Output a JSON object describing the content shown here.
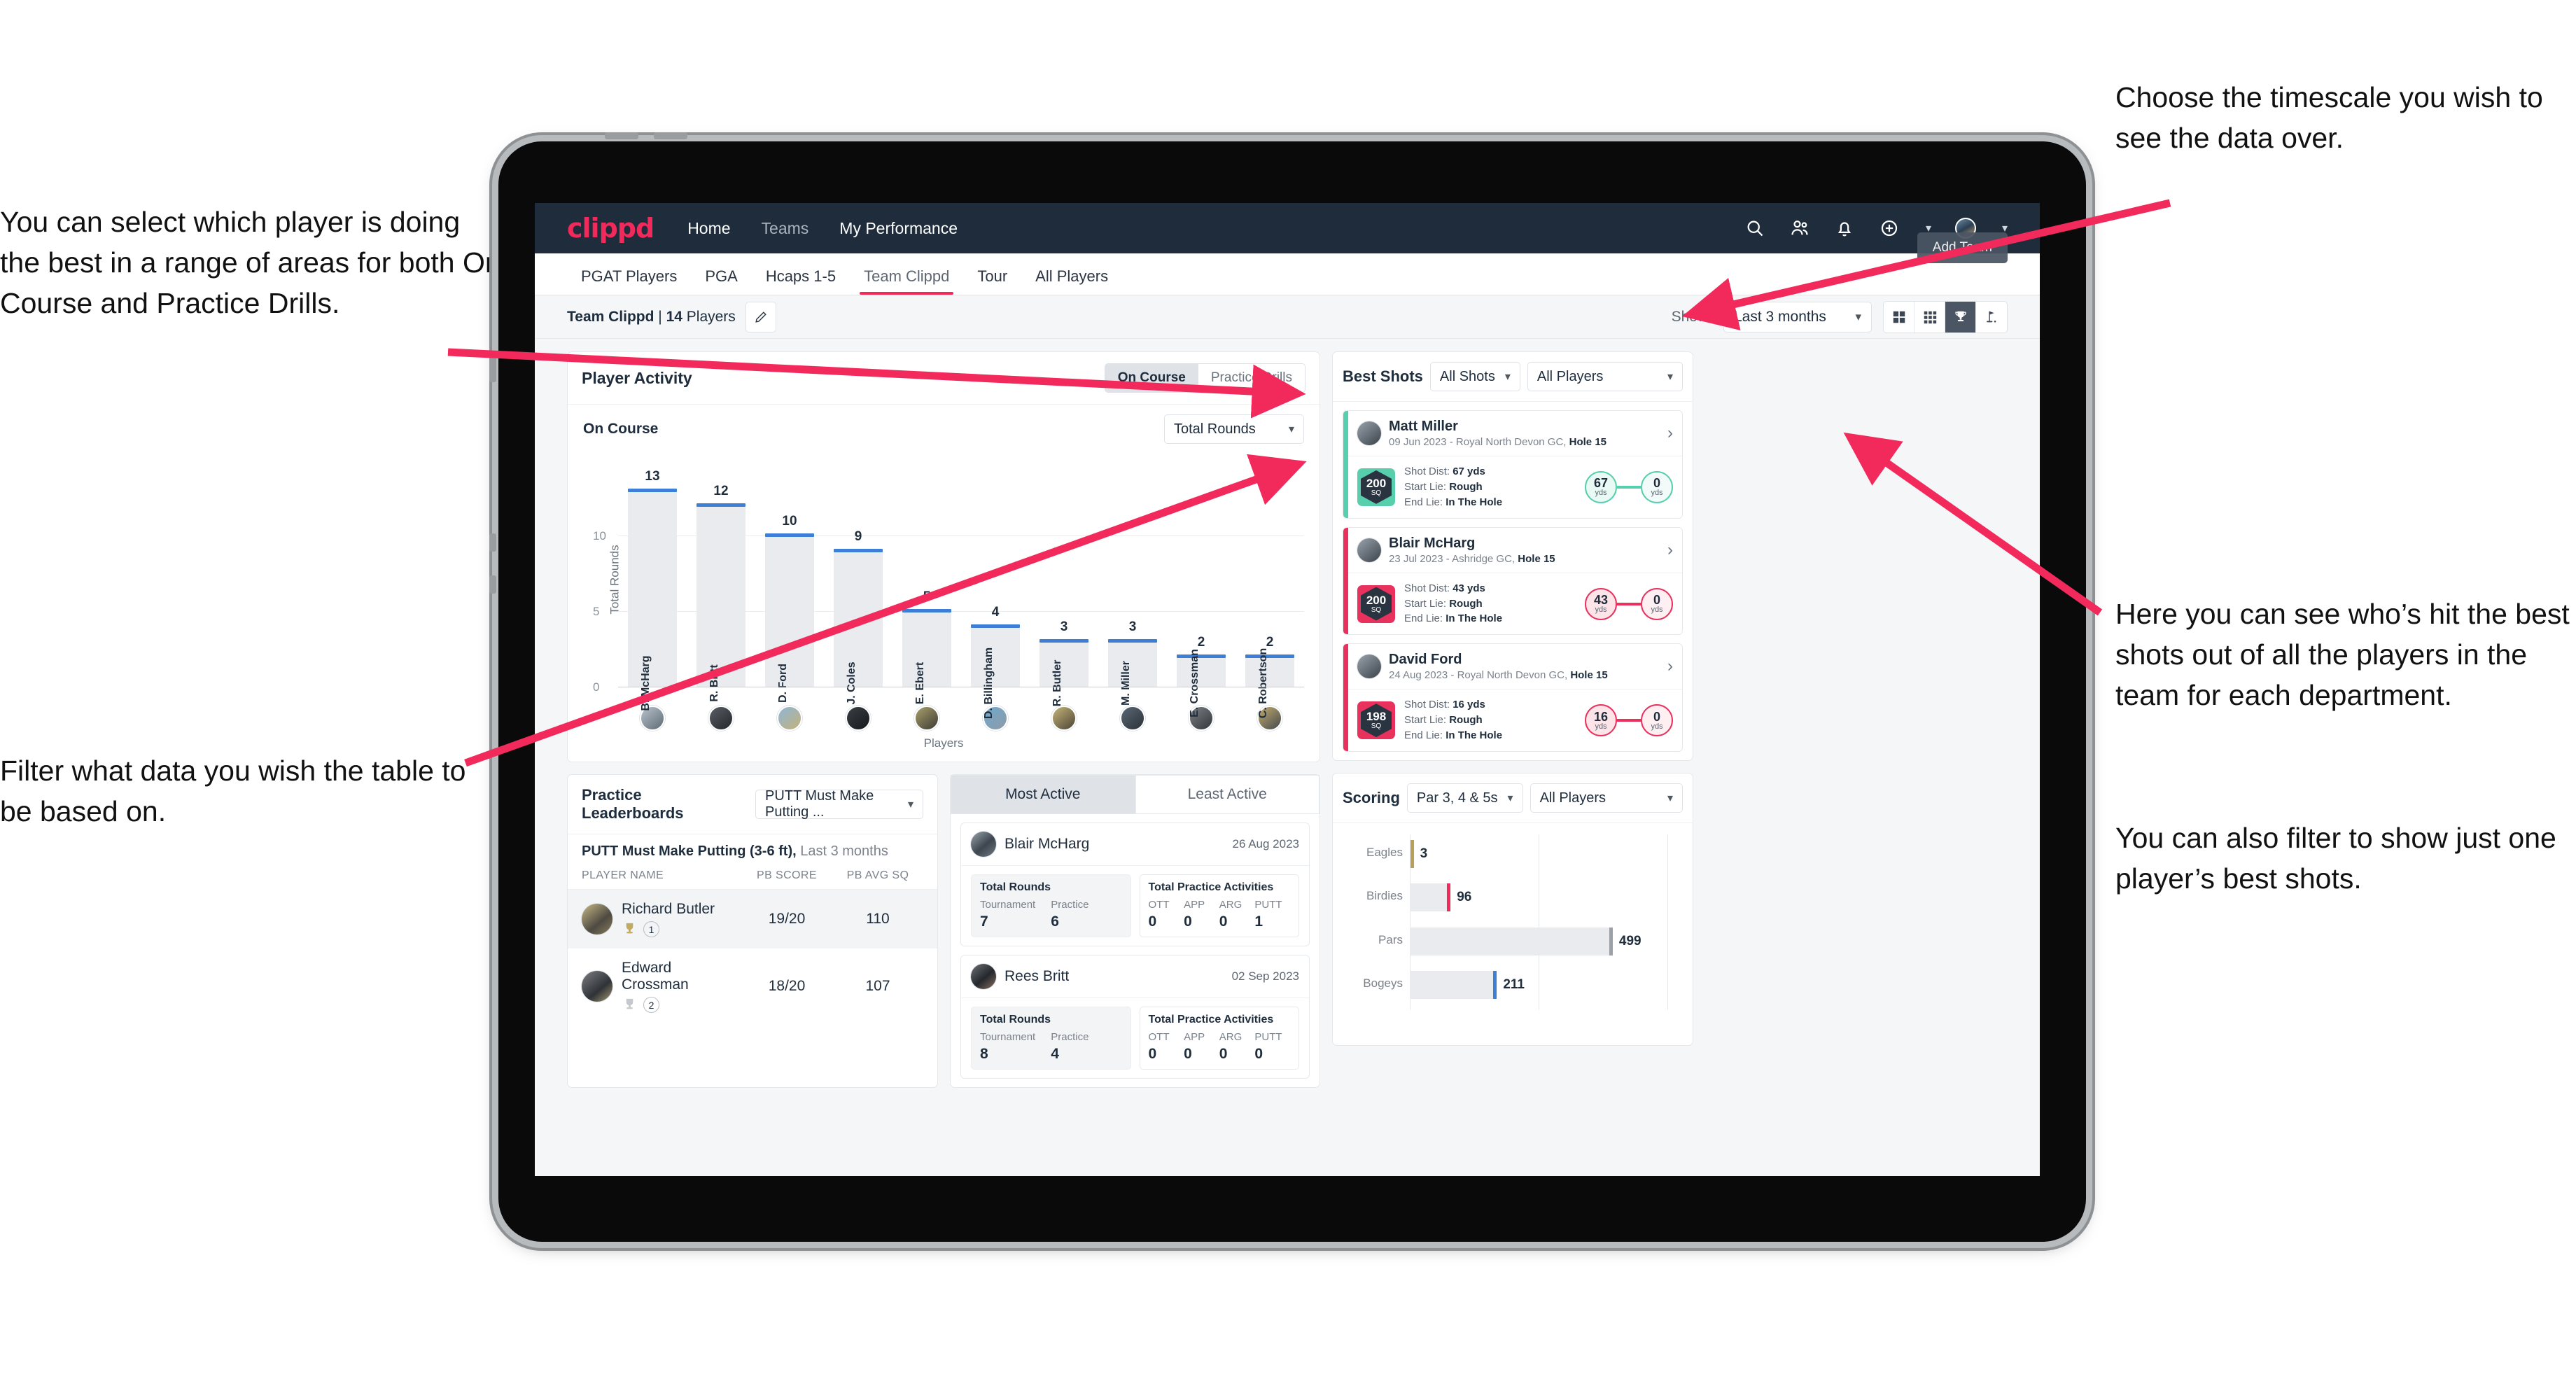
{
  "annotations": {
    "top_left": "You can select which player is doing the best in a range of areas for both On Course and Practice Drills.",
    "bottom_left": "Filter what data you wish the table to be based on.",
    "top_right": "Choose the timescale you wish to see the data over.",
    "middle_right": "Here you can see who’s hit the best shots out of all the players in the team for each department.",
    "middle_right_2": "You can also filter to show just one player’s best shots."
  },
  "topnav": {
    "logo": "clippd",
    "links": [
      {
        "label": "Home",
        "dim": false
      },
      {
        "label": "Teams",
        "dim": true
      },
      {
        "label": "My Performance",
        "dim": false
      }
    ],
    "icons": [
      "search-icon",
      "people-icon",
      "bell-icon",
      "plus-circle-icon",
      "avatar-icon"
    ]
  },
  "tabs": [
    {
      "label": "PGAT Players",
      "active": false
    },
    {
      "label": "PGA",
      "active": false
    },
    {
      "label": "Hcaps 1-5",
      "active": false
    },
    {
      "label": "Team Clippd",
      "active": true
    },
    {
      "label": "Tour",
      "active": false
    },
    {
      "label": "All Players",
      "active": false
    }
  ],
  "add_team_button": "Add Team",
  "subbar": {
    "team_name": "Team Clippd",
    "separator": " | ",
    "player_count": "14",
    "players_word": " Players",
    "show_label": "Show:",
    "timescale_value": "Last 3 months",
    "view_buttons": [
      {
        "name": "grid-2x2-view-button",
        "active": false
      },
      {
        "name": "grid-3x3-view-button",
        "active": false
      },
      {
        "name": "trophy-view-button",
        "active": true
      },
      {
        "name": "golf-flag-view-button",
        "active": false
      }
    ]
  },
  "player_activity": {
    "title": "Player Activity",
    "segments": [
      {
        "label": "On Course",
        "active": true
      },
      {
        "label": "Practice Drills",
        "active": false
      }
    ],
    "section_label": "On Course",
    "metric_dropdown": "Total Rounds"
  },
  "best_shots": {
    "title": "Best Shots",
    "shot_filter": "All Shots",
    "player_filter": "All Players",
    "items": [
      {
        "name": "Matt Miller",
        "meta_date": "09 Jun 2023 - Royal North Devon GC, ",
        "meta_hole": "Hole 15",
        "badge_value": "200",
        "badge_unit": "SQ",
        "badge_color": "#57cfad",
        "stripe_color": "#57cfad",
        "ring_color": "#57cfad",
        "shot_dist_label": "Shot Dist: ",
        "shot_dist_value": "67 yds",
        "start_lie_label": "Start Lie: ",
        "start_lie_value": "Rough",
        "end_lie_label": "End Lie: ",
        "end_lie_value": "In The Hole",
        "from_value": "67",
        "from_unit": "yds",
        "to_value": "0",
        "to_unit": "yds"
      },
      {
        "name": "Blair McHarg",
        "meta_date": "23 Jul 2023 - Ashridge GC, ",
        "meta_hole": "Hole 15",
        "badge_value": "200",
        "badge_unit": "SQ",
        "badge_color": "#e8315c",
        "stripe_color": "#e8315c",
        "ring_color": "#e8315c",
        "shot_dist_label": "Shot Dist: ",
        "shot_dist_value": "43 yds",
        "start_lie_label": "Start Lie: ",
        "start_lie_value": "Rough",
        "end_lie_label": "End Lie: ",
        "end_lie_value": "In The Hole",
        "from_value": "43",
        "from_unit": "yds",
        "to_value": "0",
        "to_unit": "yds"
      },
      {
        "name": "David Ford",
        "meta_date": "24 Aug 2023 - Royal North Devon GC, ",
        "meta_hole": "Hole 15",
        "badge_value": "198",
        "badge_unit": "SQ",
        "badge_color": "#e8315c",
        "stripe_color": "#e8315c",
        "ring_color": "#e8315c",
        "shot_dist_label": "Shot Dist: ",
        "shot_dist_value": "16 yds",
        "start_lie_label": "Start Lie: ",
        "start_lie_value": "Rough",
        "end_lie_label": "End Lie: ",
        "end_lie_value": "In The Hole",
        "from_value": "16",
        "from_unit": "yds",
        "to_value": "0",
        "to_unit": "yds"
      }
    ]
  },
  "practice_leaderboards": {
    "title": "Practice Leaderboards",
    "drill_dropdown": "PUTT Must Make Putting ...",
    "subtitle_bold": "PUTT Must Make Putting (3-6 ft),",
    "subtitle_light": " Last 3 months",
    "columns": [
      "PLAYER NAME",
      "PB SCORE",
      "PB AVG SQ"
    ],
    "rows": [
      {
        "name": "Richard Butler",
        "rank": "1",
        "trophy": "gold",
        "pb_score": "19/20",
        "pb_avg_sq": "110"
      },
      {
        "name": "Edward Crossman",
        "rank": "2",
        "trophy": "silver",
        "pb_score": "18/20",
        "pb_avg_sq": "107"
      }
    ]
  },
  "activity_panel": {
    "tabs": [
      {
        "label": "Most Active",
        "active": true
      },
      {
        "label": "Least Active",
        "active": false
      }
    ],
    "entries": [
      {
        "name": "Blair McHarg",
        "date": "26 Aug 2023",
        "rounds_title": "Total Rounds",
        "rounds": [
          {
            "key": "Tournament",
            "value": "7"
          },
          {
            "key": "Practice",
            "value": "6"
          }
        ],
        "practice_title": "Total Practice Activities",
        "practice": [
          {
            "key": "OTT",
            "value": "0"
          },
          {
            "key": "APP",
            "value": "0"
          },
          {
            "key": "ARG",
            "value": "0"
          },
          {
            "key": "PUTT",
            "value": "1"
          }
        ]
      },
      {
        "name": "Rees Britt",
        "date": "02 Sep 2023",
        "rounds_title": "Total Rounds",
        "rounds": [
          {
            "key": "Tournament",
            "value": "8"
          },
          {
            "key": "Practice",
            "value": "4"
          }
        ],
        "practice_title": "Total Practice Activities",
        "practice": [
          {
            "key": "OTT",
            "value": "0"
          },
          {
            "key": "APP",
            "value": "0"
          },
          {
            "key": "ARG",
            "value": "0"
          },
          {
            "key": "PUTT",
            "value": "0"
          }
        ]
      }
    ]
  },
  "scoring": {
    "title": "Scoring",
    "par_filter": "Par 3, 4 & 5s",
    "player_filter": "All Players"
  },
  "chart_data": [
    {
      "type": "bar",
      "title": "Player Activity — On Course",
      "xlabel": "Players",
      "ylabel": "Total Rounds",
      "ylim": [
        0,
        14
      ],
      "yticks": [
        0,
        5,
        10
      ],
      "grid": true,
      "categories": [
        "B. McHarg",
        "R. Britt",
        "D. Ford",
        "J. Coles",
        "E. Ebert",
        "D. Billingham",
        "R. Butler",
        "M. Miller",
        "E. Crossman",
        "C. Robertson"
      ],
      "values": [
        13,
        12,
        10,
        9,
        5,
        4,
        3,
        3,
        2,
        2
      ],
      "bar_color": "#e9ebee",
      "cap_color": "#3d7fd6"
    },
    {
      "type": "bar",
      "orientation": "horizontal",
      "title": "Scoring",
      "xlabel": "",
      "ylabel": "",
      "xlim": [
        0,
        640
      ],
      "categories": [
        "Eagles",
        "Birdies",
        "Pars",
        "Bogeys"
      ],
      "values": [
        3,
        96,
        499,
        211
      ],
      "cap_colors": [
        "#b9a05a",
        "#f2295b",
        "#9ba1a8",
        "#3d7fd6"
      ],
      "bar_color": "#e9ebee"
    }
  ]
}
